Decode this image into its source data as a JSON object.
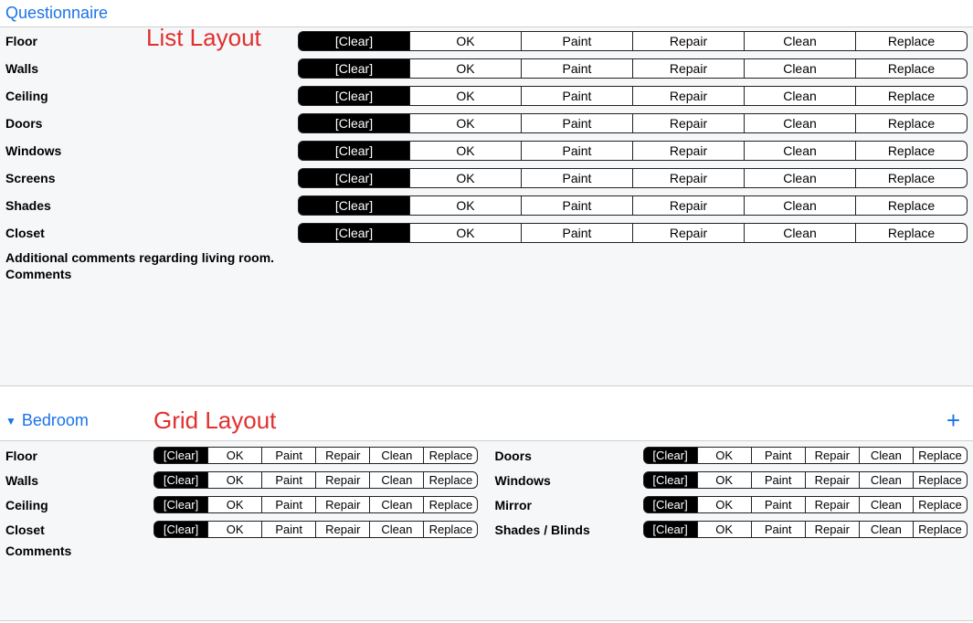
{
  "questionnaire": {
    "title": "Questionnaire",
    "layout_label": "List Layout",
    "options": [
      "[Clear]",
      "OK",
      "Paint",
      "Repair",
      "Clean",
      "Replace"
    ],
    "items": [
      {
        "label": "Floor",
        "selected": 0
      },
      {
        "label": "Walls",
        "selected": 0
      },
      {
        "label": "Ceiling",
        "selected": 0
      },
      {
        "label": "Doors",
        "selected": 0
      },
      {
        "label": "Windows",
        "selected": 0
      },
      {
        "label": "Screens",
        "selected": 0
      },
      {
        "label": "Shades",
        "selected": 0
      },
      {
        "label": "Closet",
        "selected": 0
      }
    ],
    "additional_heading": "Additional comments regarding living room.",
    "comments_label": "Comments"
  },
  "bedroom": {
    "title": "Bedroom",
    "layout_label": "Grid Layout",
    "add_icon": "plus-icon",
    "caret_icon": "caret-down-icon",
    "options": [
      "[Clear]",
      "OK",
      "Paint",
      "Repair",
      "Clean",
      "Replace"
    ],
    "left_items": [
      {
        "label": "Floor",
        "selected": 0
      },
      {
        "label": "Walls",
        "selected": 0
      },
      {
        "label": "Ceiling",
        "selected": 0
      },
      {
        "label": "Closet",
        "selected": 0
      }
    ],
    "right_items": [
      {
        "label": "Doors",
        "selected": 0
      },
      {
        "label": "Windows",
        "selected": 0
      },
      {
        "label": "Mirror",
        "selected": 0
      },
      {
        "label": "Shades / Blinds",
        "selected": 0
      }
    ],
    "comments_label": "Comments"
  }
}
